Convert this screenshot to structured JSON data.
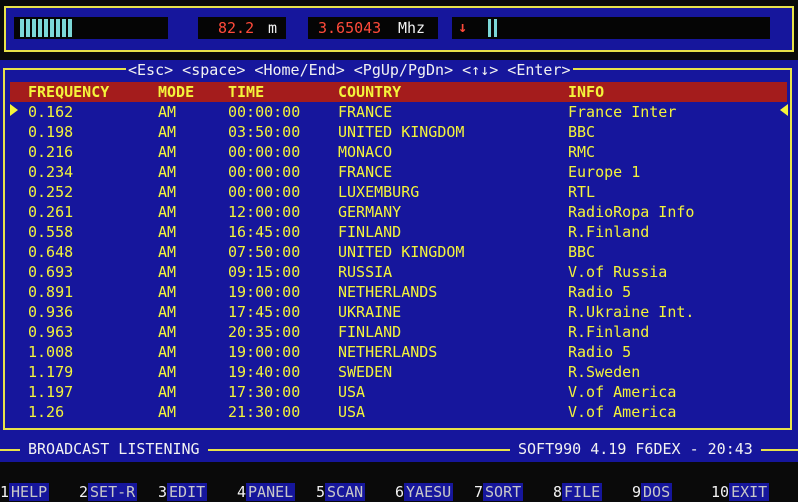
{
  "top": {
    "signal_icon": "signal-level-bar",
    "wavelength": "82.2",
    "wavelength_unit": "m",
    "frequency": "3.65043",
    "frequency_unit": "Mhz",
    "tuning_arrow": "↓",
    "signal_level_fraction": 0.6
  },
  "keys_hint": "<Esc> <space> <Home/End> <PgUp/PgDn> <↑↓> <Enter>",
  "columns": [
    "FREQUENCY",
    "MODE",
    "TIME",
    "COUNTRY",
    "INFO"
  ],
  "rows": [
    {
      "freq": "0.162",
      "mode": "AM",
      "time": "00:00:00",
      "country": "FRANCE",
      "info": "France Inter"
    },
    {
      "freq": "0.198",
      "mode": "AM",
      "time": "03:50:00",
      "country": "UNITED KINGDOM",
      "info": "BBC"
    },
    {
      "freq": "0.216",
      "mode": "AM",
      "time": "00:00:00",
      "country": "MONACO",
      "info": "RMC"
    },
    {
      "freq": "0.234",
      "mode": "AM",
      "time": "00:00:00",
      "country": "FRANCE",
      "info": "Europe 1"
    },
    {
      "freq": "0.252",
      "mode": "AM",
      "time": "00:00:00",
      "country": "LUXEMBURG",
      "info": "RTL"
    },
    {
      "freq": "0.261",
      "mode": "AM",
      "time": "12:00:00",
      "country": "GERMANY",
      "info": "RadioRopa Info"
    },
    {
      "freq": "0.558",
      "mode": "AM",
      "time": "16:45:00",
      "country": "FINLAND",
      "info": "R.Finland"
    },
    {
      "freq": "0.648",
      "mode": "AM",
      "time": "07:50:00",
      "country": "UNITED KINGDOM",
      "info": "BBC"
    },
    {
      "freq": "0.693",
      "mode": "AM",
      "time": "09:15:00",
      "country": "RUSSIA",
      "info": "V.of Russia"
    },
    {
      "freq": "0.891",
      "mode": "AM",
      "time": "19:00:00",
      "country": "NETHERLANDS",
      "info": "Radio 5"
    },
    {
      "freq": "0.936",
      "mode": "AM",
      "time": "17:45:00",
      "country": "UKRAINE",
      "info": "R.Ukraine Int."
    },
    {
      "freq": "0.963",
      "mode": "AM",
      "time": "20:35:00",
      "country": "FINLAND",
      "info": "R.Finland"
    },
    {
      "freq": "1.008",
      "mode": "AM",
      "time": "19:00:00",
      "country": "NETHERLANDS",
      "info": "Radio 5"
    },
    {
      "freq": "1.179",
      "mode": "AM",
      "time": "19:40:00",
      "country": "SWEDEN",
      "info": "R.Sweden"
    },
    {
      "freq": "1.197",
      "mode": "AM",
      "time": "17:30:00",
      "country": "USA",
      "info": "V.of America"
    },
    {
      "freq": "1.26",
      "mode": "AM",
      "time": "21:30:00",
      "country": "USA",
      "info": "V.of America"
    }
  ],
  "selected_row": 0,
  "status": {
    "mode_label": "BROADCAST LISTENING",
    "app_info": "SOFT990 4.19 F6DEX - 20:43"
  },
  "function_keys": [
    {
      "num": "1",
      "label": "HELP"
    },
    {
      "num": "2",
      "label": "SET-R"
    },
    {
      "num": "3",
      "label": "EDIT"
    },
    {
      "num": "4",
      "label": "PANEL"
    },
    {
      "num": "5",
      "label": "SCAN"
    },
    {
      "num": "6",
      "label": "YAESU"
    },
    {
      "num": "7",
      "label": "SORT"
    },
    {
      "num": "8",
      "label": "FILE"
    },
    {
      "num": "9",
      "label": "DOS"
    },
    {
      "num": "10",
      "label": "EXIT"
    }
  ],
  "colors": {
    "panel_blue": "#16169c",
    "header_red": "#a41c1c",
    "text_yellow": "#f4f43a",
    "frame_yellow": "#e8e24a",
    "readout_red": "#ff4a3a",
    "signal_cyan": "#7cd8d8"
  }
}
